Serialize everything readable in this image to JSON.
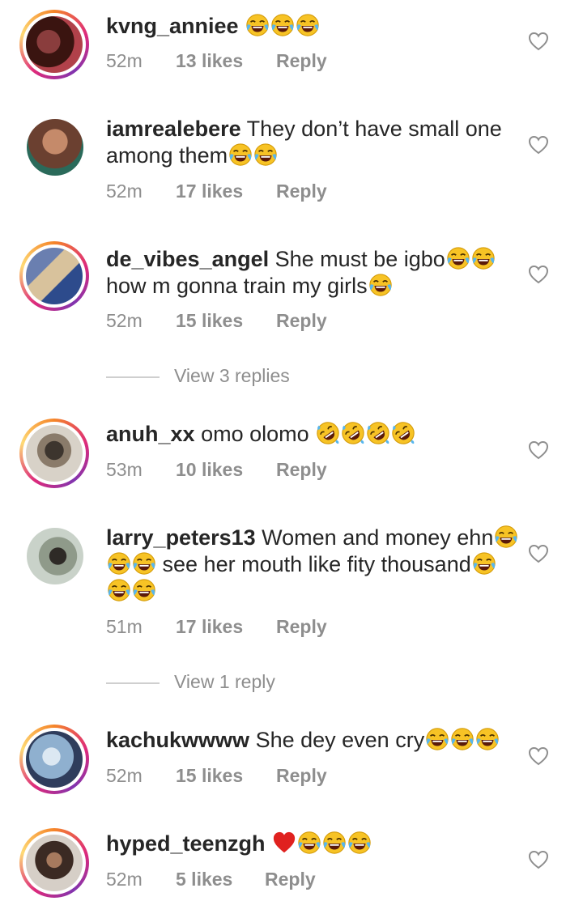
{
  "comments": [
    {
      "username": "kvng_anniee",
      "text": "",
      "emojis": [
        "laugh",
        "laugh",
        "laugh"
      ],
      "time": "52m",
      "likes": "13 likes",
      "reply": "Reply",
      "avatar_colors": [
        "#3a1410",
        "#b1414a"
      ]
    },
    {
      "username": "iamrealebere",
      "text": "They don’t have small one among them",
      "emojis": [
        "laugh",
        "laugh"
      ],
      "time": "52m",
      "likes": "17 likes",
      "reply": "Reply",
      "avatar_colors": [
        "#c58a6a",
        "#6b4030"
      ]
    },
    {
      "username": "de_vibes_angel",
      "text": "She must be igbo",
      "emojis": [
        "laugh",
        "laugh"
      ],
      "text2": "how m gonna train my girls",
      "emojis2": [
        "laugh"
      ],
      "time": "52m",
      "likes": "15 likes",
      "reply": "Reply",
      "avatar_colors": [
        "#6a7fb0",
        "#d8c29c"
      ]
    },
    {
      "username": "anuh_xx",
      "text": "omo olomo",
      "emojis": [
        "rofl",
        "rofl",
        "rofl",
        "rofl"
      ],
      "time": "53m",
      "likes": "10 likes",
      "reply": "Reply",
      "avatar_colors": [
        "#d8d2c8",
        "#3d352e"
      ]
    },
    {
      "username": "larry_peters13",
      "text": "Women and money ehn",
      "emojis": [
        "laugh",
        "laugh",
        "laugh"
      ],
      "text2": "see her mouth like fity thousand",
      "emojis2": [
        "laugh",
        "laugh",
        "laugh"
      ],
      "time": "51m",
      "likes": "17 likes",
      "reply": "Reply",
      "avatar_colors": [
        "#c9d2c9",
        "#2e2a26"
      ]
    },
    {
      "username": "kachukwwww",
      "text": "She dey even cry",
      "emojis": [
        "laugh",
        "laugh",
        "laugh"
      ],
      "time": "52m",
      "likes": "15 likes",
      "reply": "Reply",
      "avatar_colors": [
        "#8fb0cf",
        "#2f3d5c"
      ]
    },
    {
      "username": "hyped_teenzgh",
      "text": "",
      "emojis": [
        "heart",
        "laugh",
        "laugh",
        "laugh"
      ],
      "time": "52m",
      "likes": "5 likes",
      "reply": "Reply",
      "avatar_colors": [
        "#d6cfc7",
        "#3b2a23"
      ]
    }
  ],
  "view_replies": [
    {
      "label": "View 3 replies"
    },
    {
      "label": "View 1 reply"
    }
  ],
  "colors": {
    "text": "#262626",
    "meta": "#8e8e8e",
    "emoji": "#f7c325",
    "heart": "#e0211f"
  },
  "icons": {
    "like": "heart-outline-icon",
    "laugh": "face-with-tears-of-joy-icon",
    "rofl": "rolling-on-the-floor-laughing-icon",
    "red_heart": "red-heart-icon"
  }
}
